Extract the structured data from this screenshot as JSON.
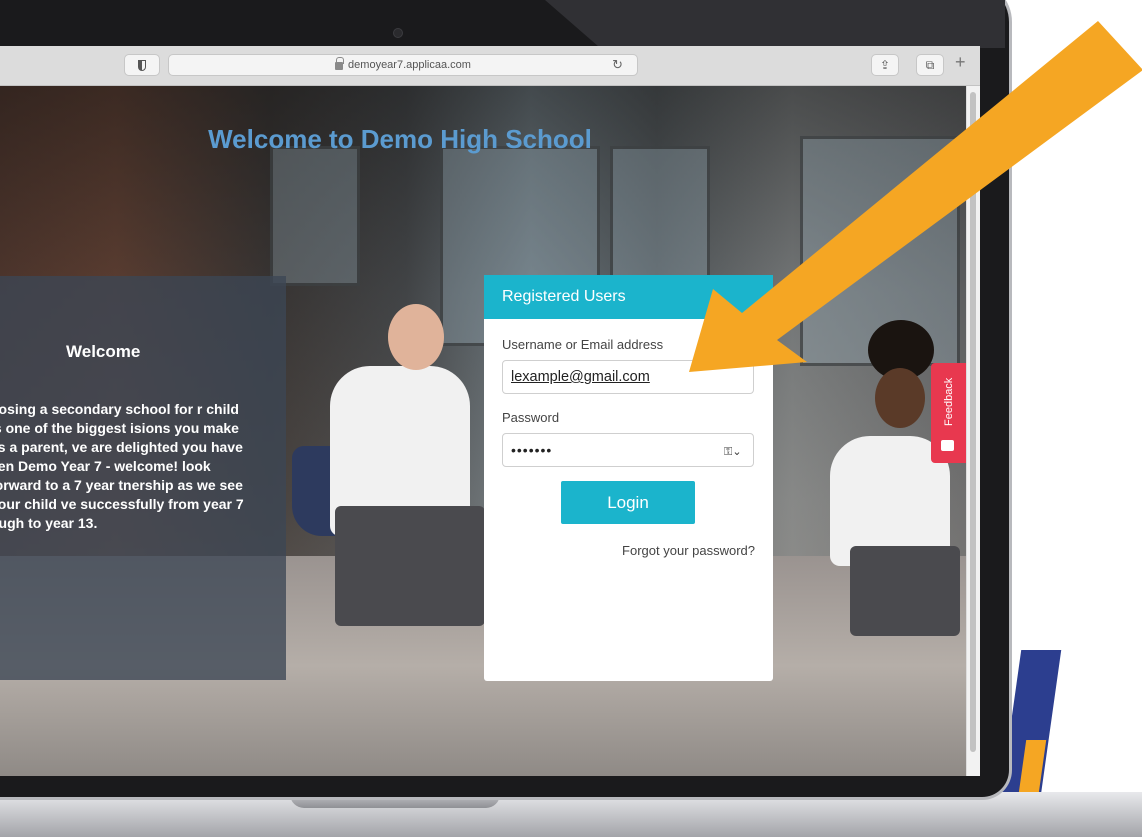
{
  "browser": {
    "url": "demoyear7.applicaa.com"
  },
  "page": {
    "title": "Welcome to Demo High School"
  },
  "welcome_panel": {
    "heading": "Welcome",
    "body": "oosing a secondary school for r child is one of the biggest isions you make as a parent, ve are delighted you have sen Demo Year 7 - welcome! look forward to a 7 year tnership as we see your child ve successfully from year 7 ough to year 13."
  },
  "login": {
    "header": "Registered Users",
    "username_label": "Username or Email address",
    "username_value": "lexample@gmail.com",
    "password_label": "Password",
    "password_value": "•••••••",
    "login_button": "Login",
    "forgot_link": "Forgot your password?"
  },
  "feedback": {
    "label": "Feedback"
  },
  "colors": {
    "accent": "#1bb4cc",
    "title": "#5b9bd0",
    "feedback": "#e8384f",
    "arrow": "#f5a623"
  }
}
